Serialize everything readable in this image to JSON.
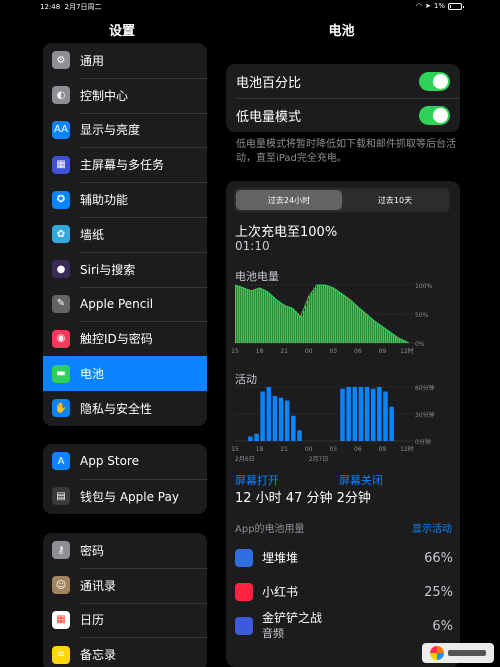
{
  "status": {
    "time": "12:48",
    "date": "2月7日周二",
    "battery": "1%"
  },
  "sidebar": {
    "title": "设置",
    "group1": [
      {
        "label": "通用",
        "icon": "gear-icon",
        "glyph": "⚙",
        "color": "#8e8e93"
      },
      {
        "label": "控制中心",
        "icon": "control-center-icon",
        "glyph": "◐",
        "color": "#8e8e93"
      },
      {
        "label": "显示与亮度",
        "icon": "display-brightness-icon",
        "glyph": "AA",
        "color": "#0a84ff"
      },
      {
        "label": "主屏幕与多任务",
        "icon": "home-screen-icon",
        "glyph": "▦",
        "color": "#3f51d6"
      },
      {
        "label": "辅助功能",
        "icon": "accessibility-icon",
        "glyph": "✪",
        "color": "#0a84ff"
      },
      {
        "label": "墙纸",
        "icon": "wallpaper-icon",
        "glyph": "✿",
        "color": "#34aadc"
      },
      {
        "label": "Siri与搜索",
        "icon": "siri-icon",
        "glyph": "●",
        "color": "#3a2a5a"
      },
      {
        "label": "Apple Pencil",
        "icon": "pencil-icon",
        "glyph": "✎",
        "color": "#636366"
      },
      {
        "label": "触控ID与密码",
        "icon": "touch-id-icon",
        "glyph": "◉",
        "color": "#ff375f"
      },
      {
        "label": "电池",
        "icon": "battery-icon",
        "glyph": "▬",
        "color": "#30d158",
        "selected": true
      },
      {
        "label": "隐私与安全性",
        "icon": "privacy-hand-icon",
        "glyph": "✋",
        "color": "#0a84ff"
      }
    ],
    "group2": [
      {
        "label": "App Store",
        "icon": "app-store-icon",
        "glyph": "A",
        "color": "#0a84ff"
      },
      {
        "label": "钱包与 Apple Pay",
        "icon": "wallet-icon",
        "glyph": "▤",
        "color": "#3a3a3c"
      }
    ],
    "group3": [
      {
        "label": "密码",
        "icon": "key-icon",
        "glyph": "⚷",
        "color": "#8e8e93"
      },
      {
        "label": "通讯录",
        "icon": "contacts-icon",
        "glyph": "☺",
        "color": "#a2845e"
      },
      {
        "label": "日历",
        "icon": "calendar-icon",
        "glyph": "▦",
        "color": "#ffffff"
      },
      {
        "label": "备忘录",
        "icon": "notes-icon",
        "glyph": "≡",
        "color": "#ffd60a"
      }
    ]
  },
  "detail": {
    "title": "电池",
    "battery_percentage_label": "电池百分比",
    "low_power_label": "低电量模式",
    "low_power_note": "低电量模式将暂时降低如下载和邮件抓取等后台活动，直至iPad完全充电。",
    "tabs": [
      "过去24小时",
      "过去10天"
    ],
    "last_charge_label": "上次充电至100%",
    "last_charge_time": "01:10",
    "battery_level_label": "电池电量",
    "activity_label": "活动",
    "level_axis": [
      "100%",
      "50%",
      "0%"
    ],
    "activity_axis": [
      "60分钟",
      "30分钟",
      "0分钟"
    ],
    "time_ticks": [
      "15",
      "18",
      "21",
      "00",
      "03",
      "06",
      "09",
      "12时"
    ],
    "date_ticks": [
      "2月6日",
      "2月7日"
    ],
    "screen_on_label": "屏幕打开",
    "screen_off_label": "屏幕关闭",
    "screen_total": "12 小时 47 分钟 2分钟",
    "usage_header": "App的电池用量",
    "usage_button": "显示活动",
    "apps": [
      {
        "name": "埋堆堆",
        "sub": "",
        "pct": "66%",
        "color": "#2f6fe0"
      },
      {
        "name": "小红书",
        "sub": "",
        "pct": "25%",
        "color": "#ff2442"
      },
      {
        "name": "金铲铲之战",
        "sub": "音频",
        "pct": "6%",
        "color": "#3b5bdb"
      }
    ]
  },
  "chart_data": [
    {
      "type": "area",
      "title": "电池电量",
      "x_ticks": [
        "15",
        "18",
        "21",
        "00",
        "03",
        "06",
        "09",
        "12时"
      ],
      "ylim": [
        0,
        100
      ],
      "y_ticks": [
        "0%",
        "50%",
        "100%"
      ],
      "x": [
        15,
        16,
        17,
        18,
        19,
        20,
        21,
        22,
        23,
        24,
        25,
        26,
        27,
        28,
        29,
        30,
        31,
        32,
        33,
        34,
        35,
        36
      ],
      "values": [
        100,
        95,
        90,
        95,
        88,
        75,
        65,
        60,
        45,
        80,
        100,
        100,
        95,
        85,
        75,
        62,
        50,
        38,
        28,
        18,
        8,
        2
      ],
      "color": "#30d158"
    },
    {
      "type": "bar",
      "title": "活动",
      "x_ticks": [
        "15",
        "18",
        "21",
        "00",
        "03",
        "06",
        "09",
        "12时"
      ],
      "ylim": [
        0,
        60
      ],
      "y_ticks": [
        "0分钟",
        "30分钟",
        "60分钟"
      ],
      "date_ticks": [
        "2月6日",
        "2月7日"
      ],
      "values": [
        0,
        0,
        5,
        8,
        55,
        60,
        50,
        48,
        45,
        28,
        12,
        0,
        0,
        0,
        0,
        0,
        0,
        58,
        60,
        60,
        60,
        60,
        58,
        60,
        55,
        38,
        0,
        0
      ],
      "color": "#0a84ff"
    }
  ]
}
